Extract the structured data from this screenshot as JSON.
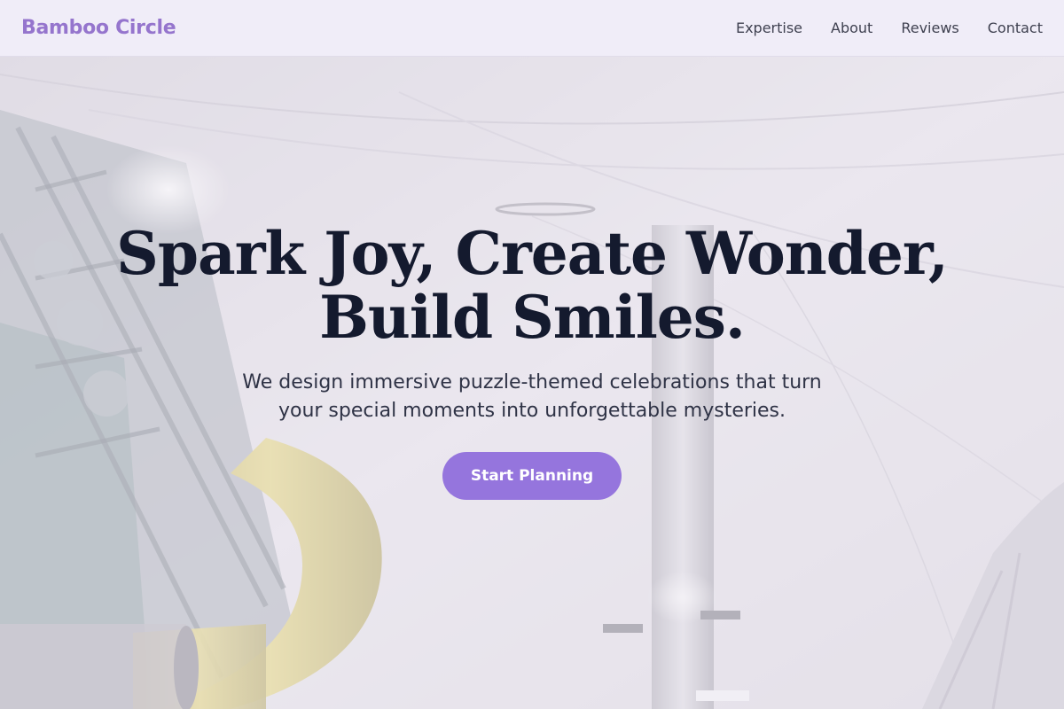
{
  "header": {
    "brand": "Bamboo Circle",
    "nav": [
      {
        "label": "Expertise"
      },
      {
        "label": "About"
      },
      {
        "label": "Reviews"
      },
      {
        "label": "Contact"
      }
    ]
  },
  "hero": {
    "title_line1": "Spark Joy, Create Wonder,",
    "title_line2": "Build Smiles.",
    "subtitle": "We design immersive puzzle-themed celebrations that turn your special moments into unforgettable mysteries.",
    "cta_label": "Start Planning"
  },
  "colors": {
    "brand": "#9575cd",
    "cta": "#9575dd",
    "title": "#141a2e",
    "nav_bg": "#f0edf8"
  }
}
